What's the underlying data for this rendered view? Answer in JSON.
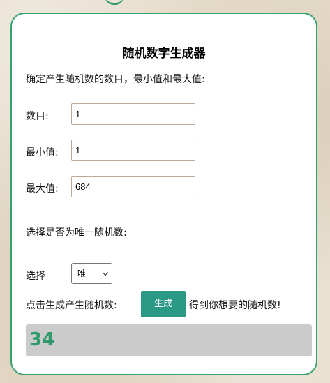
{
  "form": {
    "title": "随机数字生成器",
    "instruction": "确定产生随机数的数目，最小值和最大值:",
    "count_label": "数目:",
    "count_value": "1",
    "min_label": "最小值:",
    "min_value": "1",
    "max_label": "最大值:",
    "max_value": "684",
    "unique_prompt": "选择是否为唯一随机数:",
    "select_label": "选择",
    "select_value": "唯一",
    "generate_prompt": "点击生成产生随机数:",
    "generate_button": "生成",
    "generate_suffix": "得到你想要的随机数!",
    "result": "34"
  },
  "colors": {
    "accent": "#36a26f",
    "button": "#2b9a84",
    "result_text": "#2e9a6c",
    "result_bg": "#cbcbcb"
  },
  "icons": {
    "select_arrow": "chevron-down-icon"
  }
}
